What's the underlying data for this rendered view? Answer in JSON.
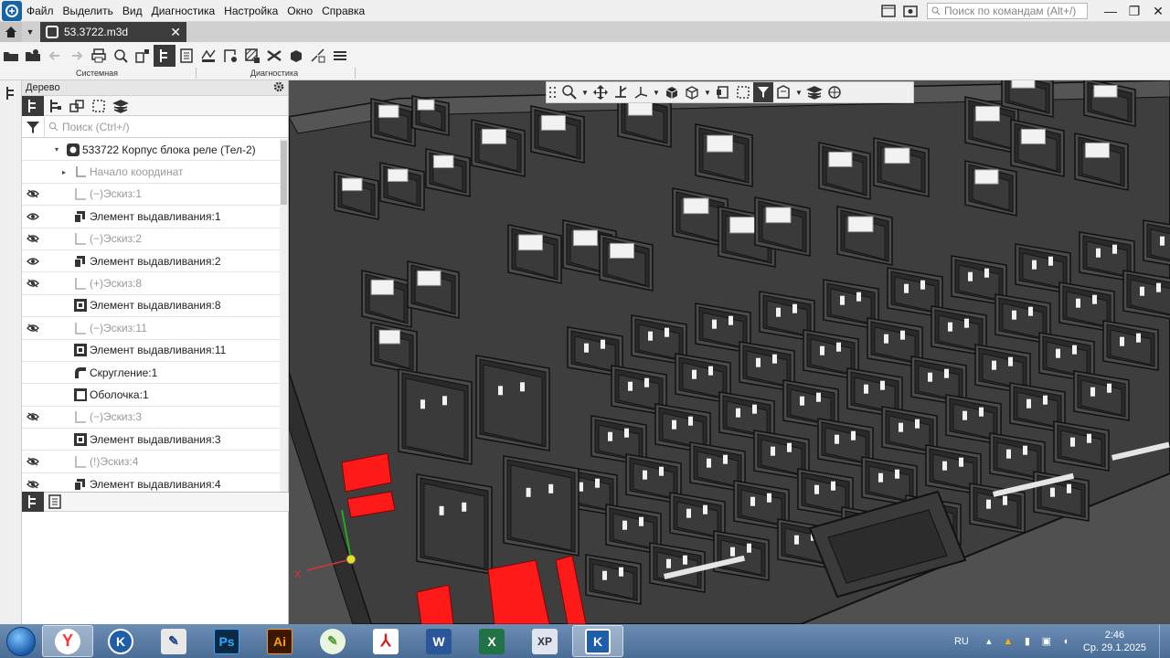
{
  "menu": {
    "items": [
      "Файл",
      "Выделить",
      "Вид",
      "Диагностика",
      "Настройка",
      "Окно",
      "Справка"
    ],
    "command_search_placeholder": "Поиск по командам (Alt+/)"
  },
  "document_tab": {
    "label": "53.3722.m3d"
  },
  "toolbar": {
    "group_system_label": "Системная",
    "group_diagnostics_label": "Диагностика"
  },
  "tree_panel": {
    "title": "Дерево",
    "search_placeholder": "Поиск (Ctrl+/)",
    "rows": [
      {
        "label": "533722 Корпус блока реле (Тел-2)",
        "eye": "",
        "icon": "part-icon",
        "indent": 1,
        "expander": "▾",
        "dim": false
      },
      {
        "label": "Начало координат",
        "eye": "",
        "icon": "origin-icon",
        "indent": 2,
        "expander": "▸",
        "dim": true
      },
      {
        "label": "(−)Эскиз:1",
        "eye": "hidden",
        "icon": "sketch-icon",
        "indent": 2,
        "expander": "",
        "dim": true
      },
      {
        "label": "Элемент выдавливания:1",
        "eye": "visible",
        "icon": "extrude-icon",
        "indent": 2,
        "expander": "",
        "dim": false
      },
      {
        "label": "(−)Эскиз:2",
        "eye": "hidden",
        "icon": "sketch-icon",
        "indent": 2,
        "expander": "",
        "dim": true
      },
      {
        "label": "Элемент выдавливания:2",
        "eye": "visible",
        "icon": "extrude-icon",
        "indent": 2,
        "expander": "",
        "dim": false
      },
      {
        "label": "(+)Эскиз:8",
        "eye": "hidden",
        "icon": "sketch-icon",
        "indent": 2,
        "expander": "",
        "dim": true
      },
      {
        "label": "Элемент выдавливания:8",
        "eye": "",
        "icon": "cut-extrude-icon",
        "indent": 2,
        "expander": "",
        "dim": false
      },
      {
        "label": "(−)Эскиз:11",
        "eye": "hidden",
        "icon": "sketch-icon",
        "indent": 2,
        "expander": "",
        "dim": true
      },
      {
        "label": "Элемент выдавливания:11",
        "eye": "",
        "icon": "cut-extrude-icon",
        "indent": 2,
        "expander": "",
        "dim": false
      },
      {
        "label": "Скругление:1",
        "eye": "",
        "icon": "fillet-icon",
        "indent": 2,
        "expander": "",
        "dim": false
      },
      {
        "label": "Оболочка:1",
        "eye": "",
        "icon": "shell-icon",
        "indent": 2,
        "expander": "",
        "dim": false
      },
      {
        "label": "(−)Эскиз:3",
        "eye": "hidden",
        "icon": "sketch-icon",
        "indent": 2,
        "expander": "",
        "dim": true
      },
      {
        "label": "Элемент выдавливания:3",
        "eye": "",
        "icon": "cut-extrude-icon",
        "indent": 2,
        "expander": "",
        "dim": false
      },
      {
        "label": "(!)Эскиз:4",
        "eye": "hidden",
        "icon": "sketch-icon",
        "indent": 2,
        "expander": "",
        "dim": true
      },
      {
        "label": "Элемент выдавливания:4",
        "eye": "hidden",
        "icon": "extrude-icon",
        "indent": 2,
        "expander": "",
        "dim": false
      }
    ]
  },
  "viewport": {
    "axis_label_x": "X",
    "colors": {
      "body": "#4a4a4a",
      "edge": "#111111",
      "highlight": "#ff1a1a",
      "background": "#505050"
    }
  },
  "taskbar": {
    "apps": [
      "yandex-browser-icon",
      "kompas-icon",
      "pen-app-icon",
      "photoshop-icon",
      "illustrator-icon",
      "inkscape-icon",
      "acrobat-icon",
      "word-icon",
      "excel-icon",
      "x-app-icon",
      "kompas-active-icon"
    ],
    "app_labels": {
      "photoshop": "Ps",
      "illustrator": "Ai",
      "word": "W",
      "excel": "X"
    },
    "language": "RU",
    "time": "2:46",
    "date": "Ср. 29.1.2025"
  }
}
